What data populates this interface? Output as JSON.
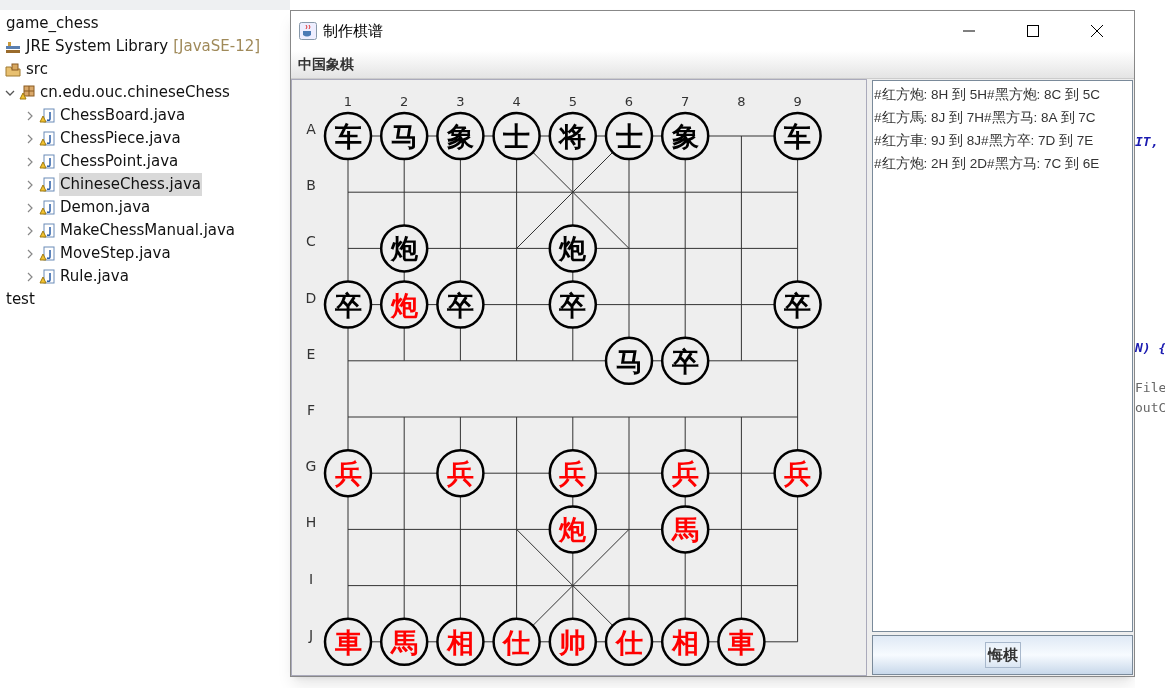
{
  "explorer": {
    "items": [
      {
        "kind": "project",
        "label": "game_chess"
      },
      {
        "kind": "library",
        "label": "JRE System Library",
        "note": "[JavaSE-12]"
      },
      {
        "kind": "source-folder",
        "label": "src"
      },
      {
        "kind": "package",
        "label": "cn.edu.ouc.chineseChess",
        "expanded": true,
        "children": [
          {
            "kind": "java-file",
            "label": "ChessBoard.java",
            "expanded": false,
            "selected": false
          },
          {
            "kind": "java-file",
            "label": "ChessPiece.java",
            "expanded": false,
            "selected": false
          },
          {
            "kind": "java-file",
            "label": "ChessPoint.java",
            "expanded": false,
            "selected": false
          },
          {
            "kind": "java-file",
            "label": "ChineseChess.java",
            "expanded": false,
            "selected": true
          },
          {
            "kind": "java-file",
            "label": "Demon.java",
            "expanded": false,
            "selected": false
          },
          {
            "kind": "java-file",
            "label": "MakeChessManual.java",
            "expanded": false,
            "selected": false
          },
          {
            "kind": "java-file",
            "label": "MoveStep.java",
            "expanded": false,
            "selected": false
          },
          {
            "kind": "java-file",
            "label": "Rule.java",
            "expanded": false,
            "selected": false
          }
        ]
      },
      {
        "kind": "project",
        "label": "test"
      }
    ]
  },
  "code_fragments": [
    {
      "kind": "keyword",
      "text": "IT,"
    },
    {
      "kind": "keyword",
      "text": "N) {"
    },
    {
      "kind": "plain",
      "text": "File"
    },
    {
      "kind": "plain",
      "text": "outC"
    }
  ],
  "window": {
    "title": "制作棋谱",
    "menu": [
      "中国象棋"
    ]
  },
  "board": {
    "files": [
      "1",
      "2",
      "3",
      "4",
      "5",
      "6",
      "7",
      "8",
      "9"
    ],
    "ranks": [
      "A",
      "B",
      "C",
      "D",
      "E",
      "F",
      "G",
      "H",
      "I",
      "J"
    ],
    "grid": [
      [
        {
          "kind": "black",
          "char": "车"
        },
        {
          "kind": "black",
          "char": "马"
        },
        {
          "kind": "black",
          "char": "象"
        },
        {
          "kind": "black",
          "char": "士"
        },
        {
          "kind": "black",
          "char": "将"
        },
        {
          "kind": "black",
          "char": "士"
        },
        {
          "kind": "black",
          "char": "象"
        },
        {
          "kind": "empty"
        },
        {
          "kind": "black",
          "char": "车"
        }
      ],
      [
        {
          "kind": "empty"
        },
        {
          "kind": "empty"
        },
        {
          "kind": "empty"
        },
        {
          "kind": "empty"
        },
        {
          "kind": "empty"
        },
        {
          "kind": "empty"
        },
        {
          "kind": "empty"
        },
        {
          "kind": "empty"
        },
        {
          "kind": "empty"
        }
      ],
      [
        {
          "kind": "empty"
        },
        {
          "kind": "black",
          "char": "炮"
        },
        {
          "kind": "empty"
        },
        {
          "kind": "empty"
        },
        {
          "kind": "black",
          "char": "炮"
        },
        {
          "kind": "empty"
        },
        {
          "kind": "empty"
        },
        {
          "kind": "empty"
        },
        {
          "kind": "empty"
        }
      ],
      [
        {
          "kind": "black",
          "char": "卒"
        },
        {
          "kind": "red",
          "char": "炮"
        },
        {
          "kind": "black",
          "char": "卒"
        },
        {
          "kind": "empty"
        },
        {
          "kind": "black",
          "char": "卒"
        },
        {
          "kind": "empty"
        },
        {
          "kind": "empty"
        },
        {
          "kind": "empty"
        },
        {
          "kind": "black",
          "char": "卒"
        }
      ],
      [
        {
          "kind": "empty"
        },
        {
          "kind": "empty"
        },
        {
          "kind": "empty"
        },
        {
          "kind": "empty"
        },
        {
          "kind": "empty"
        },
        {
          "kind": "black",
          "char": "马"
        },
        {
          "kind": "black",
          "char": "卒"
        },
        {
          "kind": "empty"
        },
        {
          "kind": "empty"
        }
      ],
      [
        {
          "kind": "empty"
        },
        {
          "kind": "empty"
        },
        {
          "kind": "empty"
        },
        {
          "kind": "empty"
        },
        {
          "kind": "empty"
        },
        {
          "kind": "empty"
        },
        {
          "kind": "empty"
        },
        {
          "kind": "empty"
        },
        {
          "kind": "empty"
        }
      ],
      [
        {
          "kind": "red",
          "char": "兵"
        },
        {
          "kind": "empty"
        },
        {
          "kind": "red",
          "char": "兵"
        },
        {
          "kind": "empty"
        },
        {
          "kind": "red",
          "char": "兵"
        },
        {
          "kind": "empty"
        },
        {
          "kind": "red",
          "char": "兵"
        },
        {
          "kind": "empty"
        },
        {
          "kind": "red",
          "char": "兵"
        }
      ],
      [
        {
          "kind": "empty"
        },
        {
          "kind": "empty"
        },
        {
          "kind": "empty"
        },
        {
          "kind": "empty"
        },
        {
          "kind": "red",
          "char": "炮"
        },
        {
          "kind": "empty"
        },
        {
          "kind": "red",
          "char": "馬"
        },
        {
          "kind": "empty"
        },
        {
          "kind": "empty"
        }
      ],
      [
        {
          "kind": "empty"
        },
        {
          "kind": "empty"
        },
        {
          "kind": "empty"
        },
        {
          "kind": "empty"
        },
        {
          "kind": "empty"
        },
        {
          "kind": "empty"
        },
        {
          "kind": "empty"
        },
        {
          "kind": "empty"
        },
        {
          "kind": "empty"
        }
      ],
      [
        {
          "kind": "red",
          "char": "車"
        },
        {
          "kind": "red",
          "char": "馬"
        },
        {
          "kind": "red",
          "char": "相"
        },
        {
          "kind": "red",
          "char": "仕"
        },
        {
          "kind": "red",
          "char": "帅"
        },
        {
          "kind": "red",
          "char": "仕"
        },
        {
          "kind": "red",
          "char": "相"
        },
        {
          "kind": "red",
          "char": "車"
        },
        {
          "kind": "empty"
        }
      ]
    ]
  },
  "move_log": [
    "#红方炮: 8H 到 5H#黑方炮: 8C 到 5C",
    "#红方馬: 8J 到 7H#黑方马: 8A 到 7C",
    "#红方車: 9J 到 8J#黑方卒: 7D 到 7E",
    "#红方炮: 2H 到 2D#黑方马: 7C 到 6E"
  ],
  "undo_button": "悔棋"
}
